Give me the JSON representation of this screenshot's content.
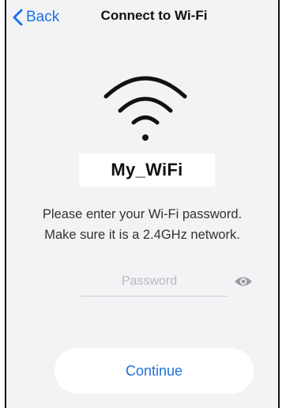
{
  "nav": {
    "back_label": "Back",
    "title": "Connect to Wi-Fi"
  },
  "network": {
    "ssid": "My_WiFi"
  },
  "instructions": {
    "line1": "Please enter your Wi-Fi password.",
    "line2": "Make sure it is a 2.4GHz network."
  },
  "password_field": {
    "value": "",
    "placeholder": "Password"
  },
  "continue_button": {
    "label": "Continue"
  },
  "icons": {
    "back": "chevron-left-icon",
    "wifi": "wifi-icon",
    "reveal": "eye-icon"
  },
  "colors": {
    "accent": "#1a73e8",
    "background": "#f3f3f6",
    "button_bg": "#ffffff",
    "text": "#111111",
    "placeholder": "#b9b9be"
  }
}
